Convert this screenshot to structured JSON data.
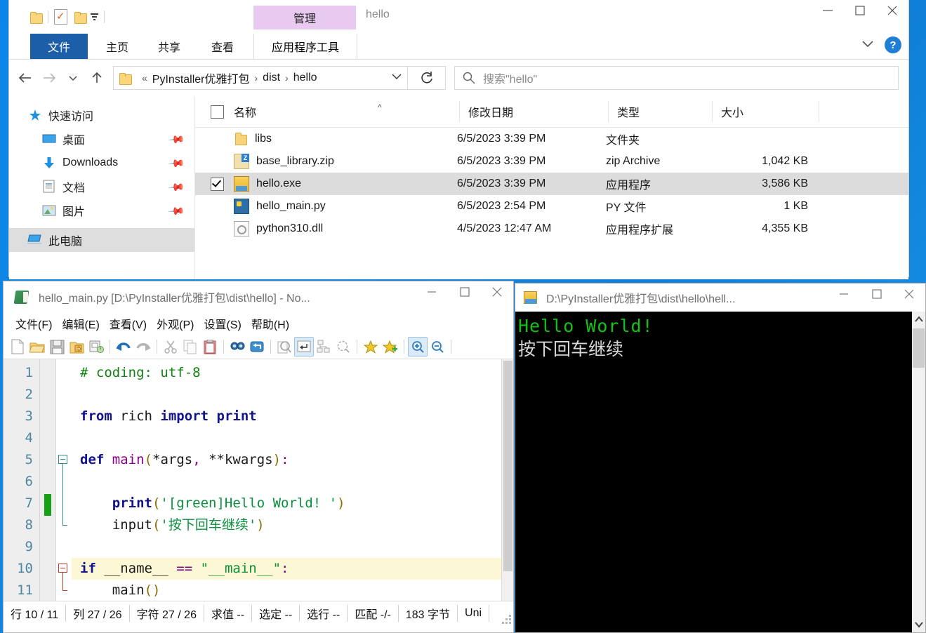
{
  "explorer": {
    "window_title": "hello",
    "contextual_tab": "管理",
    "quick_access_icons": [
      "folder-icon",
      "properties-icon",
      "new-folder-icon",
      "customize-caret-icon"
    ],
    "tabs": [
      {
        "label": "文件",
        "name": "tab-file"
      },
      {
        "label": "主页",
        "name": "tab-home"
      },
      {
        "label": "共享",
        "name": "tab-share"
      },
      {
        "label": "查看",
        "name": "tab-view"
      },
      {
        "label": "应用程序工具",
        "name": "tab-app-tools"
      }
    ],
    "address": {
      "root_sep": "«",
      "crumbs": [
        "PyInstaller优雅打包",
        "dist",
        "hello"
      ],
      "separator": "›"
    },
    "search": {
      "placeholder": "搜索\"hello\""
    },
    "nav": {
      "quick_access": "快速访问",
      "items": [
        {
          "label": "桌面",
          "icon": "desktop-icon",
          "pinned": true
        },
        {
          "label": "Downloads",
          "icon": "download-icon",
          "pinned": true
        },
        {
          "label": "文档",
          "icon": "documents-icon",
          "pinned": true
        },
        {
          "label": "图片",
          "icon": "pictures-icon",
          "pinned": true
        }
      ],
      "this_pc": "此电脑"
    },
    "columns": [
      "名称",
      "修改日期",
      "类型",
      "大小"
    ],
    "files": [
      {
        "name": "libs",
        "date": "6/5/2023 3:39 PM",
        "type": "文件夹",
        "size": "",
        "icon": "folder",
        "selected": false
      },
      {
        "name": "base_library.zip",
        "date": "6/5/2023 3:39 PM",
        "type": "zip Archive",
        "size": "1,042 KB",
        "icon": "zip",
        "selected": false
      },
      {
        "name": "hello.exe",
        "date": "6/5/2023 3:39 PM",
        "type": "应用程序",
        "size": "3,586 KB",
        "icon": "exe",
        "selected": true
      },
      {
        "name": "hello_main.py",
        "date": "6/5/2023 2:54 PM",
        "type": "PY 文件",
        "size": "1 KB",
        "icon": "py",
        "selected": false
      },
      {
        "name": "python310.dll",
        "date": "4/5/2023 12:47 AM",
        "type": "应用程序扩展",
        "size": "4,355 KB",
        "icon": "dll",
        "selected": false
      }
    ]
  },
  "notepad": {
    "title": "hello_main.py [D:\\PyInstaller优雅打包\\dist\\hello] - No...",
    "menu": [
      "文件(F)",
      "编辑(E)",
      "查看(V)",
      "外观(P)",
      "设置(S)",
      "帮助(H)"
    ],
    "toolbar_icons": [
      "new-file-icon",
      "open-folder-icon",
      "save-icon",
      "save-all-icon",
      "print-icon",
      "undo-icon",
      "redo-icon",
      "cut-icon",
      "copy-icon",
      "paste-icon",
      "find-icon",
      "replace-icon",
      "zoom-find-icon",
      "word-wrap-icon",
      "show-all-chars-icon",
      "sync-scroll-icon",
      "bookmark-icon",
      "bookmark-add-icon",
      "zoom-in-icon",
      "zoom-out-icon"
    ],
    "line_numbers": [
      "1",
      "2",
      "3",
      "4",
      "5",
      "6",
      "7",
      "8",
      "9",
      "10",
      "11"
    ],
    "code_lines": [
      {
        "n": 1,
        "tokens": [
          {
            "t": "# coding: utf-8",
            "c": "k-com"
          }
        ]
      },
      {
        "n": 2,
        "tokens": []
      },
      {
        "n": 3,
        "tokens": [
          {
            "t": "from",
            "c": "k-kw"
          },
          {
            "t": " rich ",
            "c": "k-id"
          },
          {
            "t": "import",
            "c": "k-kw"
          },
          {
            "t": " ",
            "c": "k-id"
          },
          {
            "t": "print",
            "c": "k-kw"
          }
        ]
      },
      {
        "n": 4,
        "tokens": []
      },
      {
        "n": 5,
        "tokens": [
          {
            "t": "def",
            "c": "k-kw"
          },
          {
            "t": " ",
            "c": "k-id"
          },
          {
            "t": "main",
            "c": "k-def"
          },
          {
            "t": "(",
            "c": "k-par"
          },
          {
            "t": "*args",
            "c": "k-id"
          },
          {
            "t": ",",
            "c": "k-op"
          },
          {
            "t": " ",
            "c": "k-id"
          },
          {
            "t": "**kwargs",
            "c": "k-id"
          },
          {
            "t": ")",
            "c": "k-par"
          },
          {
            "t": ":",
            "c": "k-op"
          }
        ]
      },
      {
        "n": 6,
        "tokens": []
      },
      {
        "n": 7,
        "tokens": [
          {
            "t": "    ",
            "c": "k-id"
          },
          {
            "t": "print",
            "c": "k-fn"
          },
          {
            "t": "(",
            "c": "k-par"
          },
          {
            "t": "'[green]Hello World! '",
            "c": "k-str"
          },
          {
            "t": ")",
            "c": "k-par"
          }
        ]
      },
      {
        "n": 8,
        "tokens": [
          {
            "t": "    input",
            "c": "k-id"
          },
          {
            "t": "(",
            "c": "k-par"
          },
          {
            "t": "'按下回车继续'",
            "c": "k-str"
          },
          {
            "t": ")",
            "c": "k-par"
          }
        ]
      },
      {
        "n": 9,
        "tokens": []
      },
      {
        "n": 10,
        "tokens": [
          {
            "t": "if",
            "c": "k-kw"
          },
          {
            "t": " __name__ ",
            "c": "k-id"
          },
          {
            "t": "==",
            "c": "k-op"
          },
          {
            "t": " ",
            "c": "k-id"
          },
          {
            "t": "\"__main__\"",
            "c": "k-str"
          },
          {
            "t": ":",
            "c": "k-op"
          }
        ],
        "highlight": true
      },
      {
        "n": 11,
        "tokens": [
          {
            "t": "    main",
            "c": "k-id"
          },
          {
            "t": "()",
            "c": "k-par"
          }
        ]
      }
    ],
    "status": [
      {
        "label": "行 10 / 11",
        "name": "status-line"
      },
      {
        "label": "列 27 / 26",
        "name": "status-column"
      },
      {
        "label": "字符 27 / 26",
        "name": "status-chars"
      },
      {
        "label": "求值 --",
        "name": "status-eval"
      },
      {
        "label": "选定 --",
        "name": "status-selected"
      },
      {
        "label": "选行 --",
        "name": "status-sel-lines"
      },
      {
        "label": "匹配 -/-",
        "name": "status-match"
      },
      {
        "label": "183 字节",
        "name": "status-bytes"
      },
      {
        "label": "Uni",
        "name": "status-encoding"
      }
    ]
  },
  "console": {
    "title": "D:\\PyInstaller优雅打包\\dist\\hello\\hell...",
    "lines": [
      {
        "text": "Hello World!",
        "color": "green"
      },
      {
        "text": "按下回车继续",
        "color": "white"
      }
    ]
  },
  "colors": {
    "desktop": "#1287e3",
    "file_tab": "#1c5fa8",
    "contextual_tab": "#e8c9f0",
    "selection": "#dcdcdc",
    "console_green": "#12c412",
    "highlight_line": "#fcf8d6"
  }
}
